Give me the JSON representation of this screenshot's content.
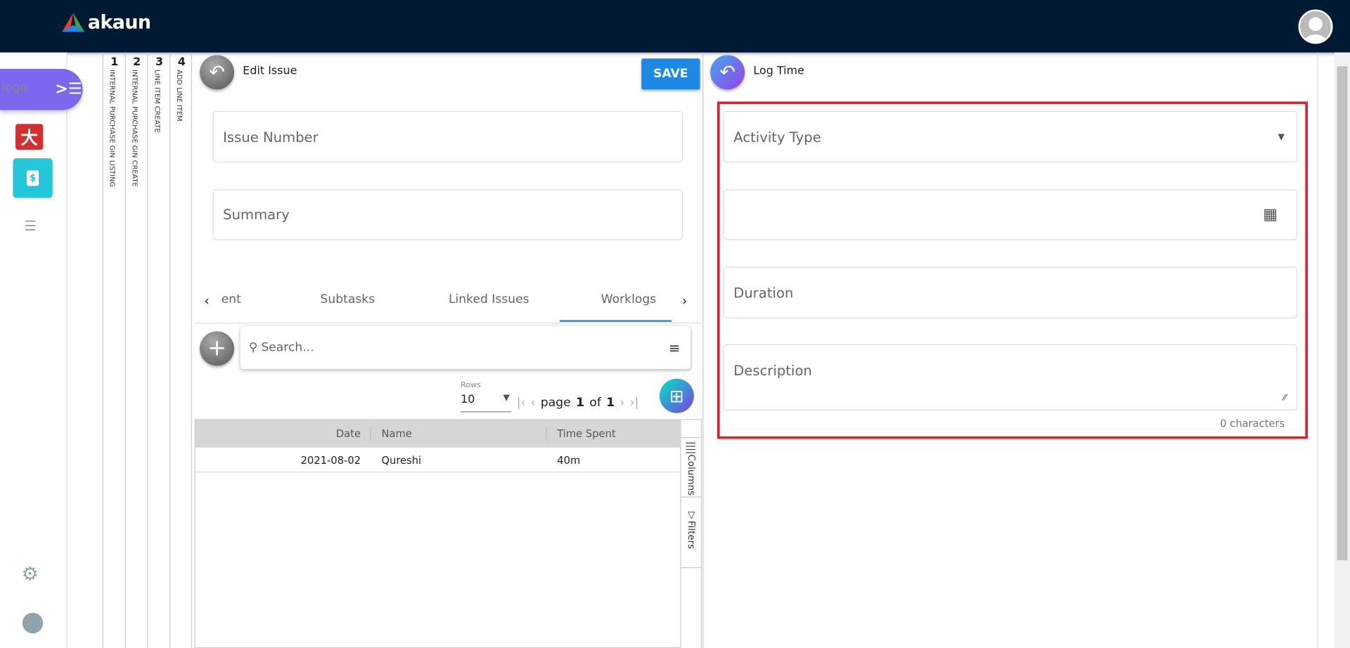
{
  "header": {
    "brand": "akaun"
  },
  "sidebar": {
    "logo_alt": "logo"
  },
  "breadcrumb_tabs": [
    {
      "num": "1",
      "label": "INTERNAL PURCHASE GIN LISTING"
    },
    {
      "num": "2",
      "label": "INTERNAL PURCHASE GIN CREATE"
    },
    {
      "num": "3",
      "label": "LINE ITEM CREATE"
    },
    {
      "num": "4",
      "label": "ADD LINE ITEM"
    }
  ],
  "edit_issue": {
    "title": "Edit Issue",
    "save": "SAVE",
    "issue_number": "Issue Number",
    "summary": "Summary",
    "tabs": [
      "ent",
      "Subtasks",
      "Linked Issues",
      "Worklogs"
    ],
    "search_placeholder": "Search...",
    "rows_label": "Rows",
    "rows_value": "10",
    "page_label": "page",
    "page": "1",
    "of_label": "of",
    "total_pages": "1",
    "columns": [
      "Date",
      "Name",
      "Time Spent"
    ],
    "rows": [
      {
        "date": "2021-08-02",
        "name": "Qureshi",
        "time": "40m"
      }
    ],
    "side_columns": "Columns",
    "side_filters": "Filters"
  },
  "log_time": {
    "title": "Log Time",
    "activity_type": "Activity Type",
    "date": "",
    "duration": "Duration",
    "description": "Description",
    "char_count": "0 characters"
  },
  "colors": {
    "topbar": "#001a33",
    "accent": "#1e88e5",
    "highlight": "#e0202a",
    "logo_pill": "#7b68ee"
  }
}
